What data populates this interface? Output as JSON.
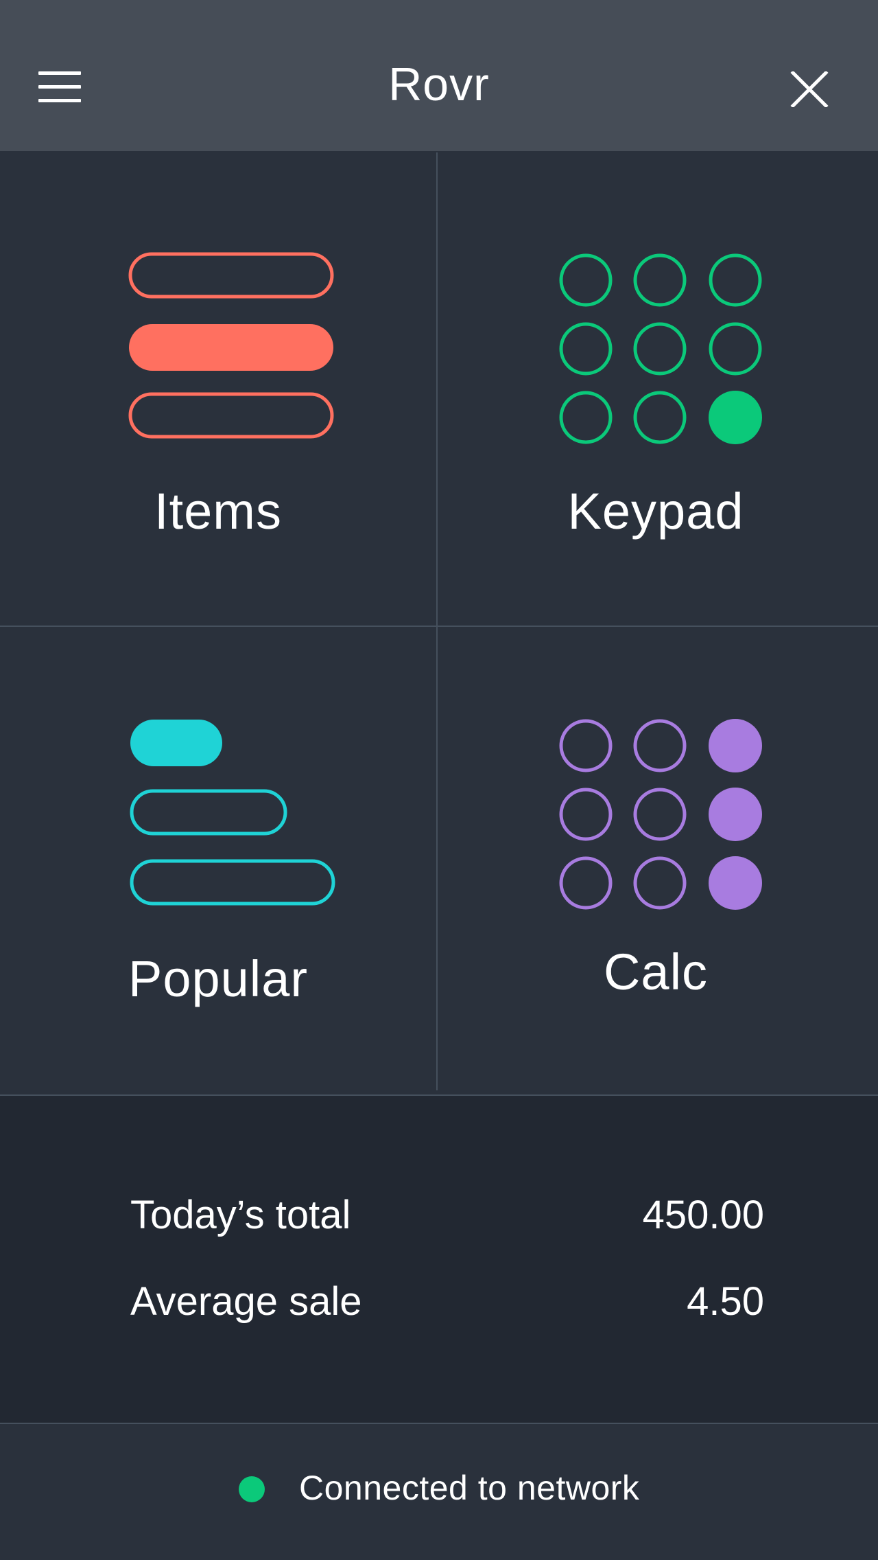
{
  "header": {
    "title": "Rovr",
    "menu_icon": "hamburger-menu-icon",
    "close_icon": "close-icon"
  },
  "tiles": [
    {
      "label": "Items",
      "icon": "list-icon",
      "color": "#ff7060"
    },
    {
      "label": "Keypad",
      "icon": "keypad-icon",
      "color": "#0bc97a"
    },
    {
      "label": "Popular",
      "icon": "popular-bars-icon",
      "color": "#1fd3d6"
    },
    {
      "label": "Calc",
      "icon": "calculator-icon",
      "color": "#a87ce0"
    }
  ],
  "summary": {
    "todays_total_label": "Today’s total",
    "todays_total_value": "450.00",
    "average_sale_label": "Average sale",
    "average_sale_value": "4.50"
  },
  "status": {
    "text": "Connected to network",
    "color": "#0bc97a"
  }
}
